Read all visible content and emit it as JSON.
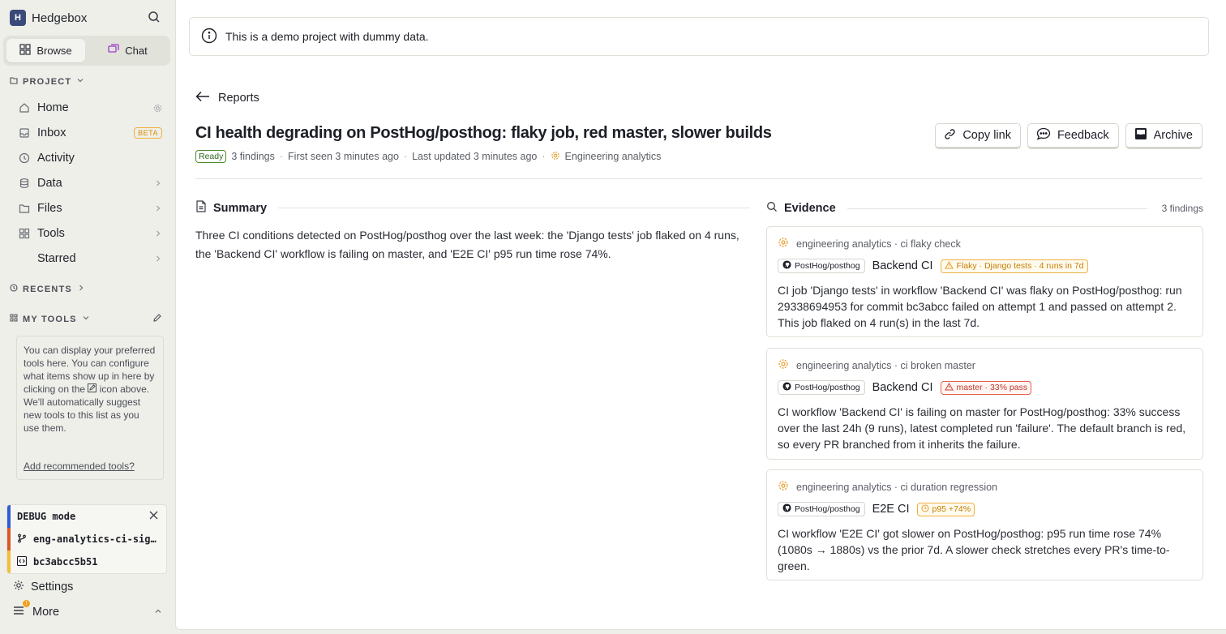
{
  "app": {
    "name": "Hedgebox",
    "logo_letter": "H"
  },
  "sidebar": {
    "tabs": [
      {
        "label": "Browse"
      },
      {
        "label": "Chat"
      }
    ],
    "project_header": "PROJECT",
    "items": [
      {
        "label": "Home",
        "icon": "home-icon"
      },
      {
        "label": "Inbox",
        "icon": "inbox-icon",
        "badge": "BETA"
      },
      {
        "label": "Activity",
        "icon": "clock-icon"
      },
      {
        "label": "Data",
        "icon": "database-icon"
      },
      {
        "label": "Files",
        "icon": "folder-icon"
      },
      {
        "label": "Tools",
        "icon": "grid-icon"
      },
      {
        "label": "Starred",
        "icon": "star-icon"
      }
    ],
    "recents_header": "RECENTS",
    "my_tools_header": "MY TOOLS",
    "my_tools_help_before": "You can display your preferred tools here. You can configure what items show up in here by clicking on the",
    "my_tools_help_after": "icon above. We'll automatically suggest new tools to this list as you use them.",
    "my_tools_link": "Add recommended tools?",
    "debug": {
      "mode_label": "DEBUG mode",
      "branch": "eng-analytics-ci-signals",
      "commit": "bc3abcc5b51"
    },
    "settings_label": "Settings",
    "more_label": "More"
  },
  "banner": {
    "text": "This is a demo project with dummy data."
  },
  "report": {
    "back_label": "Reports",
    "title": "CI health degrading on PostHog/posthog: flaky job, red master, slower builds",
    "status": "Ready",
    "findings": "3 findings",
    "first_seen": "First seen 3 minutes ago",
    "last_updated": "Last updated 3 minutes ago",
    "source": "Engineering analytics",
    "actions": {
      "copy_link": "Copy link",
      "feedback": "Feedback",
      "archive": "Archive"
    },
    "summary_title": "Summary",
    "summary_text": "Three CI conditions detected on PostHog/posthog over the last week: the 'Django tests' job flaked on 4 runs, the 'Backend CI' workflow is failing on master, and 'E2E CI' p95 run time rose 74%.",
    "evidence_title": "Evidence",
    "evidence_count": "3 findings",
    "evidence": [
      {
        "source": "engineering analytics · ci flaky check",
        "repo": "PostHog/posthog",
        "name": "Backend CI",
        "tag": "Flaky · Django tests · 4 runs in 7d",
        "tag_color": "#f0b040",
        "text": "CI job 'Django tests' in workflow 'Backend CI' was flaky on PostHog/posthog: run 29338694953 for commit bc3abcc failed on attempt 1 and passed on attempt 2. This job flaked on 4 run(s) in the last 7d."
      },
      {
        "source": "engineering analytics · ci broken master",
        "repo": "PostHog/posthog",
        "name": "Backend CI",
        "tag": "master · 33% pass",
        "tag_color": "#e06050",
        "text": "CI workflow 'Backend CI' is failing on master for PostHog/posthog: 33% success over the last 24h (9 runs), latest completed run 'failure'. The default branch is red, so every PR branched from it inherits the failure."
      },
      {
        "source": "engineering analytics · ci duration regression",
        "repo": "PostHog/posthog",
        "name": "E2E CI",
        "tag": "p95 +74%",
        "tag_color": "#f0b040",
        "text": "CI workflow 'E2E CI' got slower on PostHog/posthog: p95 run time rose 74% (1080s → 1880s) vs the prior 7d. A slower check stretches every PR's time-to-green."
      }
    ]
  }
}
